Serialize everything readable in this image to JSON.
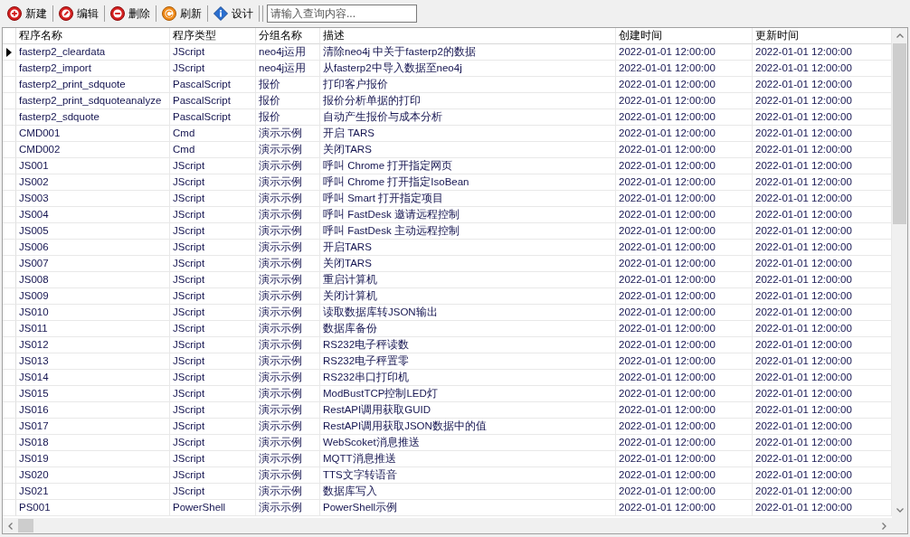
{
  "toolbar": {
    "buttons": [
      {
        "label": "新建",
        "kind": "new"
      },
      {
        "label": "编辑",
        "kind": "edit"
      },
      {
        "label": "删除",
        "kind": "delete"
      },
      {
        "label": "刷新",
        "kind": "refresh"
      },
      {
        "label": "设计",
        "kind": "design"
      }
    ],
    "search": {
      "placeholder": "请输入查询内容..."
    }
  },
  "table": {
    "columns": [
      "程序名称",
      "程序类型",
      "分组名称",
      "描述",
      "创建时间",
      "更新时间"
    ],
    "rows": [
      {
        "selected": true,
        "cells": [
          "fasterp2_cleardata",
          "JScript",
          "neo4j运用",
          "清除neo4j 中关于fasterp2的数据",
          "2022-01-01 12:00:00",
          "2022-01-01 12:00:00"
        ]
      },
      {
        "selected": false,
        "cells": [
          "fasterp2_import",
          "JScript",
          "neo4j运用",
          "从fasterp2中导入数据至neo4j",
          "2022-01-01 12:00:00",
          "2022-01-01 12:00:00"
        ]
      },
      {
        "selected": false,
        "cells": [
          "fasterp2_print_sdquote",
          "PascalScript",
          "报价",
          "打印客户报价",
          "2022-01-01 12:00:00",
          "2022-01-01 12:00:00"
        ]
      },
      {
        "selected": false,
        "cells": [
          "fasterp2_print_sdquoteanalyze",
          "PascalScript",
          "报价",
          "报价分析单据的打印",
          "2022-01-01 12:00:00",
          "2022-01-01 12:00:00"
        ]
      },
      {
        "selected": false,
        "cells": [
          "fasterp2_sdquote",
          "PascalScript",
          "报价",
          "自动产生报价与成本分析",
          "2022-01-01 12:00:00",
          "2022-01-01 12:00:00"
        ]
      },
      {
        "selected": false,
        "cells": [
          "CMD001",
          "Cmd",
          "演示示例",
          "开启 TARS",
          "2022-01-01 12:00:00",
          "2022-01-01 12:00:00"
        ]
      },
      {
        "selected": false,
        "cells": [
          "CMD002",
          "Cmd",
          "演示示例",
          "关闭TARS",
          "2022-01-01 12:00:00",
          "2022-01-01 12:00:00"
        ]
      },
      {
        "selected": false,
        "cells": [
          "JS001",
          "JScript",
          "演示示例",
          "呼叫 Chrome 打开指定网页",
          "2022-01-01 12:00:00",
          "2022-01-01 12:00:00"
        ]
      },
      {
        "selected": false,
        "cells": [
          "JS002",
          "JScript",
          "演示示例",
          "呼叫 Chrome 打开指定IsoBean",
          "2022-01-01 12:00:00",
          "2022-01-01 12:00:00"
        ]
      },
      {
        "selected": false,
        "cells": [
          "JS003",
          "JScript",
          "演示示例",
          "呼叫 Smart 打开指定项目",
          "2022-01-01 12:00:00",
          "2022-01-01 12:00:00"
        ]
      },
      {
        "selected": false,
        "cells": [
          "JS004",
          "JScript",
          "演示示例",
          "呼叫 FastDesk 邀请远程控制",
          "2022-01-01 12:00:00",
          "2022-01-01 12:00:00"
        ]
      },
      {
        "selected": false,
        "cells": [
          "JS005",
          "JScript",
          "演示示例",
          "呼叫 FastDesk 主动远程控制",
          "2022-01-01 12:00:00",
          "2022-01-01 12:00:00"
        ]
      },
      {
        "selected": false,
        "cells": [
          "JS006",
          "JScript",
          "演示示例",
          "开启TARS",
          "2022-01-01 12:00:00",
          "2022-01-01 12:00:00"
        ]
      },
      {
        "selected": false,
        "cells": [
          "JS007",
          "JScript",
          "演示示例",
          "关闭TARS",
          "2022-01-01 12:00:00",
          "2022-01-01 12:00:00"
        ]
      },
      {
        "selected": false,
        "cells": [
          "JS008",
          "JScript",
          "演示示例",
          "重启计算机",
          "2022-01-01 12:00:00",
          "2022-01-01 12:00:00"
        ]
      },
      {
        "selected": false,
        "cells": [
          "JS009",
          "JScript",
          "演示示例",
          "关闭计算机",
          "2022-01-01 12:00:00",
          "2022-01-01 12:00:00"
        ]
      },
      {
        "selected": false,
        "cells": [
          "JS010",
          "JScript",
          "演示示例",
          "读取数据库转JSON输出",
          "2022-01-01 12:00:00",
          "2022-01-01 12:00:00"
        ]
      },
      {
        "selected": false,
        "cells": [
          "JS011",
          "JScript",
          "演示示例",
          "数据库备份",
          "2022-01-01 12:00:00",
          "2022-01-01 12:00:00"
        ]
      },
      {
        "selected": false,
        "cells": [
          "JS012",
          "JScript",
          "演示示例",
          "RS232电子秤读数",
          "2022-01-01 12:00:00",
          "2022-01-01 12:00:00"
        ]
      },
      {
        "selected": false,
        "cells": [
          "JS013",
          "JScript",
          "演示示例",
          "RS232电子秤置零",
          "2022-01-01 12:00:00",
          "2022-01-01 12:00:00"
        ]
      },
      {
        "selected": false,
        "cells": [
          "JS014",
          "JScript",
          "演示示例",
          "RS232串口打印机",
          "2022-01-01 12:00:00",
          "2022-01-01 12:00:00"
        ]
      },
      {
        "selected": false,
        "cells": [
          "JS015",
          "JScript",
          "演示示例",
          "ModBustTCP控制LED灯",
          "2022-01-01 12:00:00",
          "2022-01-01 12:00:00"
        ]
      },
      {
        "selected": false,
        "cells": [
          "JS016",
          "JScript",
          "演示示例",
          "RestAPI调用获取GUID",
          "2022-01-01 12:00:00",
          "2022-01-01 12:00:00"
        ]
      },
      {
        "selected": false,
        "cells": [
          "JS017",
          "JScript",
          "演示示例",
          "RestAPI调用获取JSON数据中的值",
          "2022-01-01 12:00:00",
          "2022-01-01 12:00:00"
        ]
      },
      {
        "selected": false,
        "cells": [
          "JS018",
          "JScript",
          "演示示例",
          "WebScoket消息推送",
          "2022-01-01 12:00:00",
          "2022-01-01 12:00:00"
        ]
      },
      {
        "selected": false,
        "cells": [
          "JS019",
          "JScript",
          "演示示例",
          "MQTT消息推送",
          "2022-01-01 12:00:00",
          "2022-01-01 12:00:00"
        ]
      },
      {
        "selected": false,
        "cells": [
          "JS020",
          "JScript",
          "演示示例",
          "TTS文字转语音",
          "2022-01-01 12:00:00",
          "2022-01-01 12:00:00"
        ]
      },
      {
        "selected": false,
        "cells": [
          "JS021",
          "JScript",
          "演示示例",
          "数据库写入",
          "2022-01-01 12:00:00",
          "2022-01-01 12:00:00"
        ]
      },
      {
        "selected": false,
        "cells": [
          "PS001",
          "PowerShell",
          "演示示例",
          "PowerShell示例",
          "2022-01-01 12:00:00",
          "2022-01-01 12:00:00"
        ]
      }
    ]
  }
}
